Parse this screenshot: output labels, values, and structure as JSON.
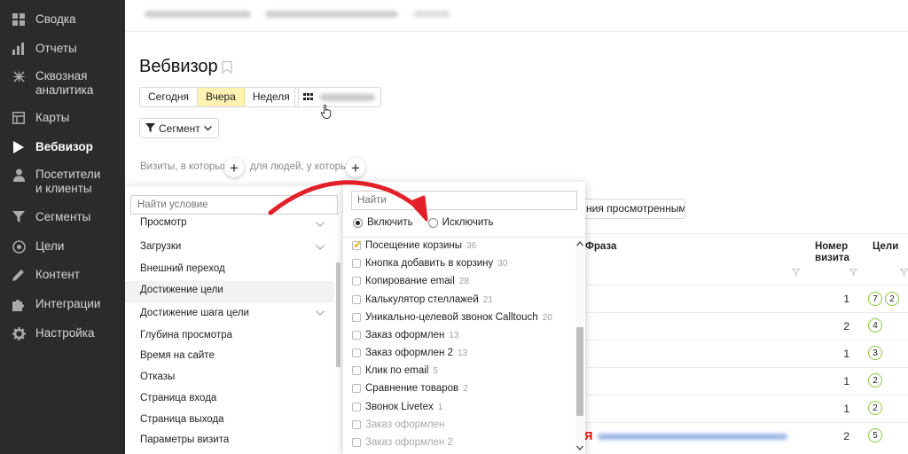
{
  "sidebar": {
    "items": [
      {
        "label": "Сводка",
        "icon": "grid-icon"
      },
      {
        "label": "Отчеты",
        "icon": "bar-chart-icon"
      },
      {
        "label": "Сквозная аналитика",
        "icon": "sparkle-icon"
      },
      {
        "label": "Карты",
        "icon": "map-icon"
      },
      {
        "label": "Вебвизор",
        "icon": "play-icon"
      },
      {
        "label": "Посетители и клиенты",
        "icon": "user-icon"
      },
      {
        "label": "Сегменты",
        "icon": "funnel-icon"
      },
      {
        "label": "Цели",
        "icon": "target-icon"
      },
      {
        "label": "Контент",
        "icon": "pencil-icon"
      },
      {
        "label": "Интеграции",
        "icon": "puzzle-icon"
      },
      {
        "label": "Настройка",
        "icon": "gear-icon"
      }
    ],
    "active_index": 4
  },
  "page": {
    "title": "Вебвизор",
    "period": [
      "Сегодня",
      "Вчера",
      "Неделя"
    ],
    "period_active": "Вчера",
    "segment_label": "Сегмент",
    "visits_label": "Визиты, в которых",
    "people_label": "для людей, у которых",
    "plus": "+"
  },
  "conditions": {
    "search_placeholder": "Найти условие",
    "items": [
      "Просмотр",
      "Загрузки",
      "Внешний переход",
      "Достижение цели",
      "Достижение шага цели",
      "Глубина просмотра",
      "Время на сайте",
      "Отказы",
      "Страница входа",
      "Страница выхода",
      "Параметры визита"
    ],
    "highlighted": "Достижение цели"
  },
  "goals": {
    "search_placeholder": "Найти",
    "include_label": "Включить",
    "exclude_label": "Исключить",
    "items": [
      {
        "name": "Посещение корзины",
        "count": "36",
        "checked": true
      },
      {
        "name": "Кнопка добавить в корзину",
        "count": "30",
        "checked": false
      },
      {
        "name": "Копирование email",
        "count": "28",
        "checked": false
      },
      {
        "name": "Калькулятор стеллажей",
        "count": "21",
        "checked": false
      },
      {
        "name": "Уникально-целевой звонок Calltouch",
        "count": "20",
        "checked": false
      },
      {
        "name": "Заказ оформлен",
        "count": "13",
        "checked": false
      },
      {
        "name": "Заказ оформлен 2",
        "count": "13",
        "checked": false
      },
      {
        "name": "Клик по email",
        "count": "5",
        "checked": false
      },
      {
        "name": "Сравнение товаров",
        "count": "2",
        "checked": false
      },
      {
        "name": "Звонок Livetex",
        "count": "1",
        "checked": false
      },
      {
        "name": "Заказ оформлен",
        "count": "",
        "checked": false
      },
      {
        "name": "Заказ оформлен 2",
        "count": "",
        "checked": false
      }
    ]
  },
  "table": {
    "viewed_button": "ния просмотренными",
    "col_phrase": "Фраза",
    "col_visit_num": "Номер визита",
    "col_goals": "Цели",
    "rows": [
      {
        "visit": "1",
        "goals": [
          "7",
          "2"
        ]
      },
      {
        "visit": "2",
        "goals": [
          "4"
        ]
      },
      {
        "visit": "1",
        "goals": [
          "3"
        ]
      },
      {
        "visit": "1",
        "goals": [
          "2"
        ]
      },
      {
        "visit": "1",
        "goals": [
          "2"
        ]
      },
      {
        "visit": "2",
        "goals": [
          "5"
        ]
      }
    ],
    "yandex_mark": "Я"
  },
  "colors": {
    "sidebar_bg": "#2b2b2b",
    "active_period": "#fff2b3",
    "goal_badge": "#8dc63f",
    "annotation_arrow": "#e3202a"
  }
}
